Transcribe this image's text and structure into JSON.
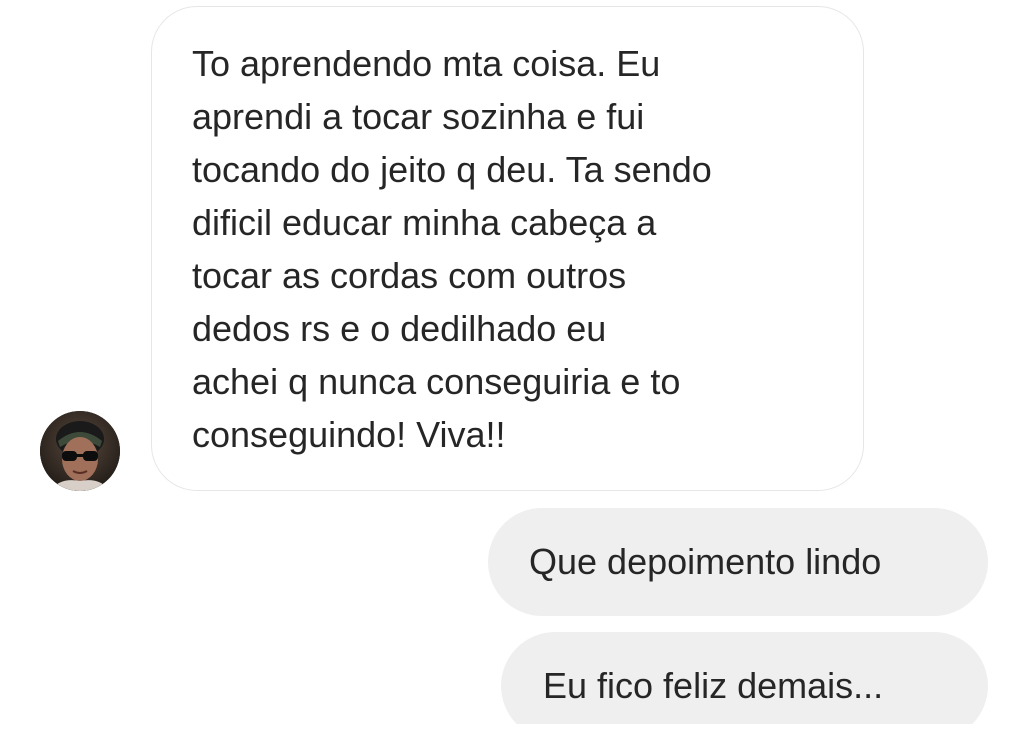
{
  "messages": {
    "incoming": {
      "lines": [
        "To aprendendo mta coisa. Eu",
        "aprendi a tocar sozinha e fui",
        "tocando do jeito q deu. Ta sendo",
        "dificil educar minha cabeça a",
        "tocar as cordas com outros",
        "dedos rs e o dedilhado eu",
        "achei q nunca conseguiria e to",
        "conseguindo! Viva!!"
      ]
    },
    "outgoing": [
      {
        "text": "Que depoimento lindo"
      },
      {
        "text": "Eu fico feliz demais..."
      }
    ]
  },
  "avatar": {
    "icon": "user-avatar-photo"
  },
  "colors": {
    "incoming_bubble_border": "#e6e6e6",
    "outgoing_bubble_bg": "#efefef",
    "text": "#262626",
    "background": "#ffffff"
  }
}
